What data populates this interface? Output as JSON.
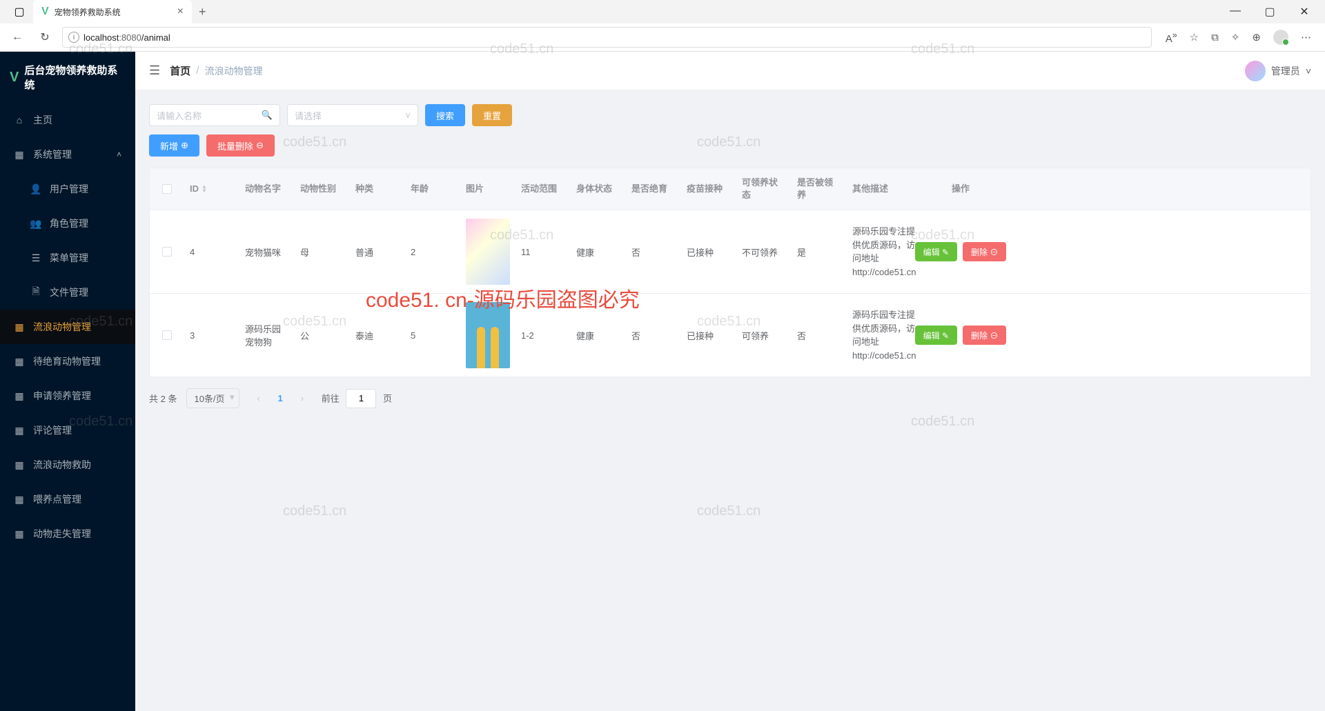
{
  "browser": {
    "tab_title": "宠物领养救助系统",
    "url_host": "localhost",
    "url_port": ":8080",
    "url_path": "/animal",
    "aa_icon": "A"
  },
  "sidebar": {
    "brand": "后台宠物领养救助系统",
    "items": [
      {
        "label": "主页",
        "icon": "⌂"
      },
      {
        "label": "系统管理",
        "icon": "▦",
        "arrow": "˄"
      },
      {
        "label": "用户管理",
        "icon": "👤",
        "sub": true
      },
      {
        "label": "角色管理",
        "icon": "👥",
        "sub": true
      },
      {
        "label": "菜单管理",
        "icon": "☰",
        "sub": true
      },
      {
        "label": "文件管理",
        "icon": "🗎",
        "sub": true
      },
      {
        "label": "流浪动物管理",
        "icon": "▦",
        "active": true
      },
      {
        "label": "待绝育动物管理",
        "icon": "▦"
      },
      {
        "label": "申请领养管理",
        "icon": "▦"
      },
      {
        "label": "评论管理",
        "icon": "▦"
      },
      {
        "label": "流浪动物救助",
        "icon": "▦"
      },
      {
        "label": "喂养点管理",
        "icon": "▦"
      },
      {
        "label": "动物走失管理",
        "icon": "▦"
      }
    ]
  },
  "topbar": {
    "home": "首页",
    "current": "流浪动物管理",
    "user": "管理员"
  },
  "toolbar": {
    "search_placeholder": "请输入名称",
    "select_placeholder": "请选择",
    "search_btn": "搜索",
    "reset_btn": "重置",
    "add_btn": "新增",
    "bulk_delete_btn": "批量删除"
  },
  "table": {
    "headers": {
      "id": "ID",
      "name": "动物名字",
      "gender": "动物性别",
      "type": "种类",
      "age": "年龄",
      "img": "图片",
      "range": "活动范围",
      "health": "身体状态",
      "neuter": "是否绝育",
      "vaccine": "疫苗接种",
      "adopt": "可领养状态",
      "adopted": "是否被领养",
      "desc": "其他描述",
      "ops": "操作"
    },
    "rows": [
      {
        "id": "4",
        "name": "宠物猫咪",
        "gender": "母",
        "type": "普通",
        "age": "2",
        "range": "11",
        "health": "健康",
        "neuter": "否",
        "vaccine": "已接种",
        "adopt": "不可领养",
        "adopted": "是",
        "desc": "源码乐园专注提供优质源码，访问地址http://code51.cn"
      },
      {
        "id": "3",
        "name": "源码乐园宠物狗",
        "gender": "公",
        "type": "泰迪",
        "age": "5",
        "range": "1-2",
        "health": "健康",
        "neuter": "否",
        "vaccine": "已接种",
        "adopt": "可领养",
        "adopted": "否",
        "desc": "源码乐园专注提供优质源码，访问地址http://code51.cn"
      }
    ],
    "edit_label": "编辑",
    "delete_label": "删除"
  },
  "pagination": {
    "total": "共 2 条",
    "page_size": "10条/页",
    "current": "1",
    "goto_prefix": "前往",
    "goto_value": "1",
    "goto_suffix": "页"
  },
  "watermarks": {
    "grey": "code51.cn",
    "red": "code51. cn-源码乐园盗图必究"
  }
}
